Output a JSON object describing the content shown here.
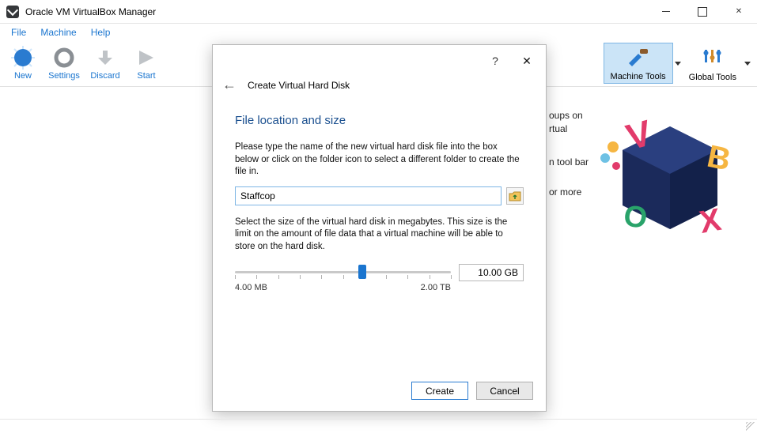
{
  "window": {
    "title": "Oracle VM VirtualBox Manager"
  },
  "menu": {
    "file": "File",
    "machine": "Machine",
    "help": "Help"
  },
  "toolbar": {
    "new": "New",
    "settings": "Settings",
    "discard": "Discard",
    "start": "Start"
  },
  "right_tools": {
    "machine_tools": "Machine Tools",
    "global_tools": "Global Tools"
  },
  "background_hints": {
    "line1a": "oups on",
    "line1b": "rtual",
    "line2": "n tool bar",
    "line3": "or more"
  },
  "dialog": {
    "title": "Create Virtual Hard Disk",
    "section": "File location and size",
    "hint1": "Please type the name of the new virtual hard disk file into the box below or click on the folder icon to select a different folder to create the file in.",
    "file_value": "Staffcop",
    "hint2": "Select the size of the virtual hard disk in megabytes. This size is the limit on the amount of file data that a virtual machine will be able to store on the hard disk.",
    "size_value": "10.00 GB",
    "range_min": "4.00 MB",
    "range_max": "2.00 TB",
    "btn_create": "Create",
    "btn_cancel": "Cancel",
    "help": "?",
    "close": "✕"
  }
}
